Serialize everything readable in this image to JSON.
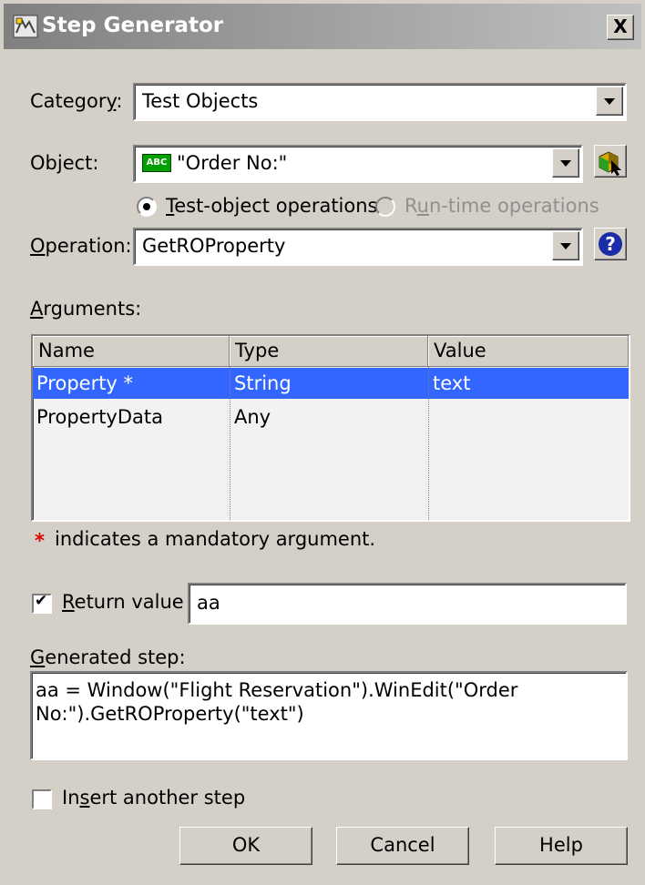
{
  "window": {
    "title": "Step Generator",
    "close_symbol": "X"
  },
  "category": {
    "label_pre": "Categor",
    "label_accel": "y",
    "label_post": ":",
    "value": "Test Objects"
  },
  "object": {
    "label": "Object:",
    "badge": "ABC",
    "value": "\"Order No:\""
  },
  "operations": {
    "test_object": {
      "accel": "T",
      "rest": "est-object operations",
      "selected": true
    },
    "run_time": {
      "pre": "R",
      "accel": "u",
      "rest": "n-time operations",
      "enabled": false
    }
  },
  "operation": {
    "label_accel": "O",
    "label_rest": "peration:",
    "value": "GetROProperty",
    "help_symbol": "?"
  },
  "arguments": {
    "label_accel": "A",
    "label_rest": "rguments:",
    "columns": [
      "Name",
      "Type",
      "Value"
    ],
    "rows": [
      {
        "name": "Property *",
        "type": "String",
        "value": "text"
      },
      {
        "name": "PropertyData",
        "type": "Any",
        "value": ""
      }
    ]
  },
  "mandatory_note": {
    "star": "*",
    "text": "indicates a mandatory argument."
  },
  "return_value": {
    "checked": true,
    "label_accel": "R",
    "label_rest": "eturn value",
    "value": "aa"
  },
  "generated_step": {
    "label_accel": "G",
    "label_rest": "enerated step:",
    "line1": "aa = Window(\"Flight Reservation\").WinEdit(\"Order",
    "line2": "No:\").GetROProperty(\"text\")"
  },
  "insert_another": {
    "checked": false,
    "pre": "In",
    "accel": "s",
    "rest": "ert another step"
  },
  "buttons": {
    "ok": "OK",
    "cancel": "Cancel",
    "help": "Help"
  },
  "colors": {
    "selection": "#3366ff",
    "face": "#d4d0c8",
    "mandatory_star": "#e00000",
    "help_icon": "#1a2ca8"
  }
}
